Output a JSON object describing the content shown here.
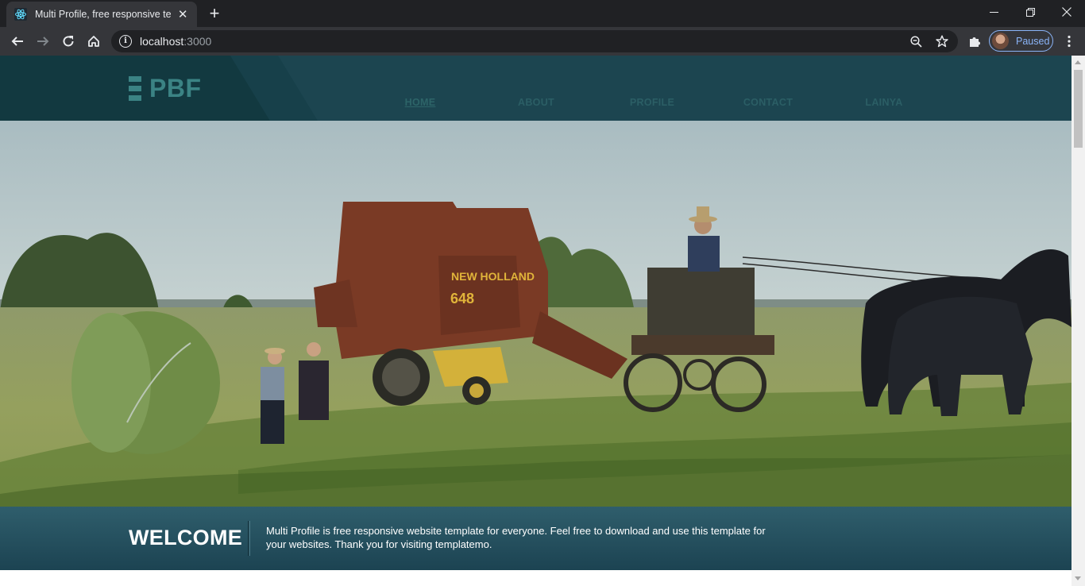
{
  "browser": {
    "tab": {
      "title": "Multi Profile, free responsive template",
      "favicon": "react-icon"
    },
    "address": {
      "host": "localhost",
      "port": ":3000"
    },
    "profile": {
      "status": "Paused"
    },
    "colors": {
      "tabbar": "#202124",
      "toolbar": "#35363a",
      "accent": "#8ab4f8"
    }
  },
  "site": {
    "logo_text": "PBF",
    "nav": [
      {
        "label": "HOME",
        "active": true
      },
      {
        "label": "ABOUT",
        "active": false
      },
      {
        "label": "PROFILE",
        "active": false
      },
      {
        "label": "CONTACT",
        "active": false
      },
      {
        "label": "LAINYA",
        "active": false
      }
    ],
    "hero": {
      "baler_brand": "NEW HOLLAND",
      "baler_model": "648"
    },
    "welcome": {
      "title": "WELCOME",
      "text": "Multi Profile is free responsive website template for everyone. Feel free to download and use this template for your websites. Thank you for visiting templatemo."
    },
    "colors": {
      "header": "#1c4550",
      "logo": "#3b8384",
      "welcome_top": "#2f5e6c",
      "welcome_bottom": "#1c4352"
    }
  }
}
